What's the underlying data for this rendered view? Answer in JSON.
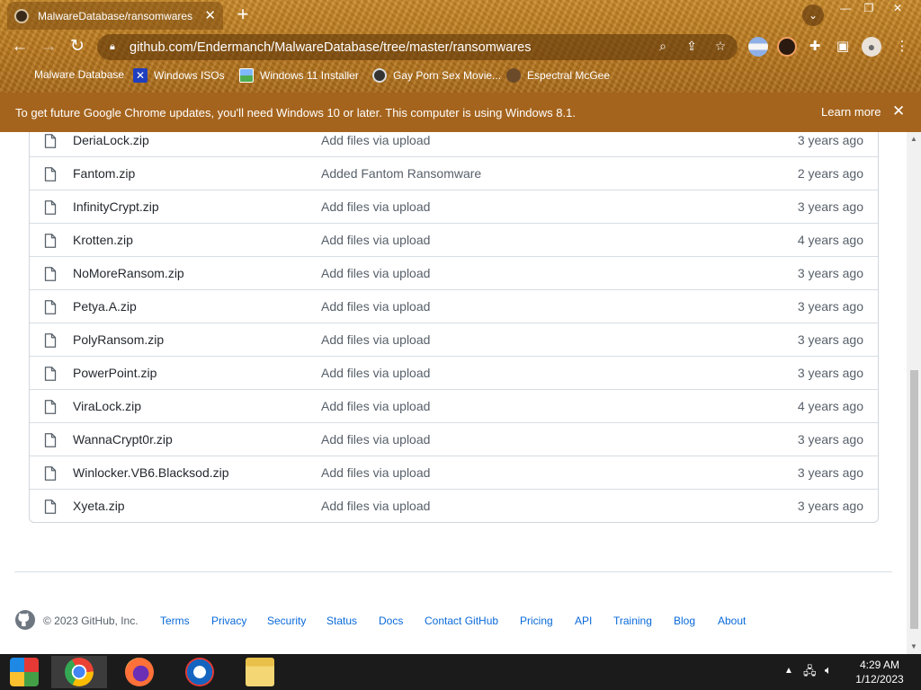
{
  "browser": {
    "tab_title": "MalwareDatabase/ransomwares a",
    "url": "github.com/Endermanch/MalwareDatabase/tree/master/ransomwares",
    "bookmarks": [
      {
        "label": "Malware Database"
      },
      {
        "label": "Windows ISOs"
      },
      {
        "label": "Windows 11 Installer"
      },
      {
        "label": "Gay Porn Sex Movie..."
      },
      {
        "label": "Espectral McGee"
      }
    ],
    "infobar_text": "To get future Google Chrome updates, you'll need Windows 10 or later. This computer is using Windows 8.1.",
    "infobar_link": "Learn more"
  },
  "files": [
    {
      "name": "DeriaLock.zip",
      "message": "Add files via upload",
      "age": "3 years ago"
    },
    {
      "name": "Fantom.zip",
      "message": "Added Fantom Ransomware",
      "age": "2 years ago"
    },
    {
      "name": "InfinityCrypt.zip",
      "message": "Add files via upload",
      "age": "3 years ago"
    },
    {
      "name": "Krotten.zip",
      "message": "Add files via upload",
      "age": "4 years ago"
    },
    {
      "name": "NoMoreRansom.zip",
      "message": "Add files via upload",
      "age": "3 years ago"
    },
    {
      "name": "Petya.A.zip",
      "message": "Add files via upload",
      "age": "3 years ago"
    },
    {
      "name": "PolyRansom.zip",
      "message": "Add files via upload",
      "age": "3 years ago"
    },
    {
      "name": "PowerPoint.zip",
      "message": "Add files via upload",
      "age": "3 years ago"
    },
    {
      "name": "ViraLock.zip",
      "message": "Add files via upload",
      "age": "4 years ago"
    },
    {
      "name": "WannaCrypt0r.zip",
      "message": "Add files via upload",
      "age": "3 years ago"
    },
    {
      "name": "Winlocker.VB6.Blacksod.zip",
      "message": "Add files via upload",
      "age": "3 years ago"
    },
    {
      "name": "Xyeta.zip",
      "message": "Add files via upload",
      "age": "3 years ago"
    }
  ],
  "footer": {
    "copyright": "© 2023 GitHub, Inc.",
    "links": [
      "Terms",
      "Privacy",
      "Security",
      "Status",
      "Docs",
      "Contact GitHub",
      "Pricing",
      "API",
      "Training",
      "Blog",
      "About"
    ]
  },
  "taskbar": {
    "time": "4:29 AM",
    "date": "1/12/2023"
  },
  "colors": {
    "infobar": "#a5641d",
    "link": "#0969da",
    "taskbar": "#1b1b1b"
  }
}
